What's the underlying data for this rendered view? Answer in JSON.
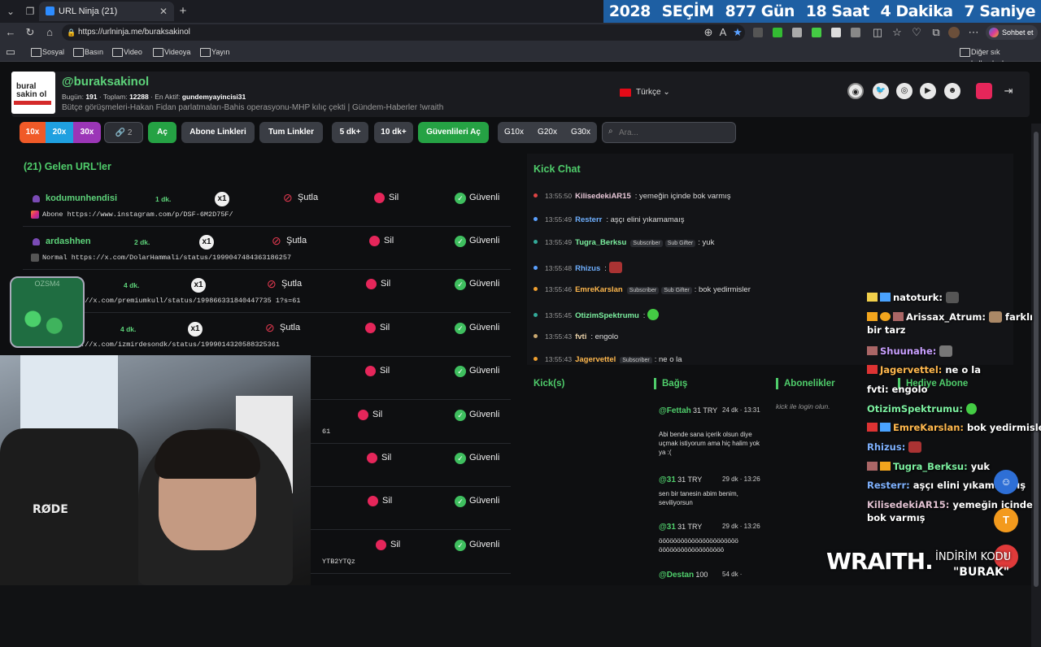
{
  "browser": {
    "tab_title": "URL Ninja (21)",
    "url": "https://urlninja.me/buraksakinol",
    "copilot_label": "Sohbet et",
    "bookmarks": [
      "Sosyal",
      "Basın",
      "Video",
      "Videoya",
      "Yayın"
    ],
    "other_bookmarks": "Diğer sık kullanılanlar"
  },
  "countdown": {
    "year": "2028",
    "election": "SEÇİM",
    "days": "877 Gün",
    "hours": "18 Saat",
    "minutes": "4 Dakika",
    "seconds": "7 Saniye"
  },
  "profile": {
    "logo_text_1": "bural",
    "logo_text_2": "sakin",
    "logo_text_3": "ol",
    "username": "@buraksakinol",
    "today_label": "Bugün:",
    "today": "191",
    "total_label": "Toplam:",
    "total": "12288",
    "active_label": "En Aktif:",
    "active": "gundemyayincisi31",
    "bio": "Bütçe görüşmeleri-Hakan Fidan parlatmaları-Bahis operasyonu-MHP kılıç çekti | Gündem-Haberler !wraith",
    "language": "Türkçe"
  },
  "toolbar": {
    "b10x": "10x",
    "b20x": "20x",
    "b30x": "30x",
    "link_count": "2",
    "ac": "Aç",
    "abone_linkleri": "Abone Linkleri",
    "tum_linkler": "Tum Linkler",
    "dk5": "5 dk+",
    "dk10": "10 dk+",
    "guvenli_ac": "Güvenlileri Aç",
    "g10": "G10x",
    "g20": "G20x",
    "g30": "G30x",
    "search_placeholder": "Ara..."
  },
  "list": {
    "title": "(21) Gelen URL'ler",
    "sutla": "Şutla",
    "sil": "Sil",
    "guvenli": "Güvenli",
    "x1": "x1",
    "rows": [
      {
        "user": "kodumunhendisi",
        "time": "1 dk.",
        "link": "Abone https://www.instagram.com/p/DSF-6M2D75F/"
      },
      {
        "user": "ardashhen",
        "time": "2 dk.",
        "link": "Normal https://x.com/DolarHammali/status/1999047484363186257"
      },
      {
        "user": "",
        "time": "4 dk.",
        "link": "s://x.com/premiumkull/status/199866331840447735 1?s=61"
      },
      {
        "user": "",
        "time": "4 dk.",
        "link": "s://x.com/izmirdesondk/status/1999014320588325361"
      },
      {
        "user": "",
        "time": "",
        "link": ""
      },
      {
        "user": "",
        "time": "",
        "link": "61"
      },
      {
        "user": "",
        "time": "",
        "link": ""
      },
      {
        "user": "",
        "time": "",
        "link": ""
      },
      {
        "user": "",
        "time": "",
        "link": "YTB2YTQz"
      }
    ]
  },
  "kick_chat": {
    "title": "Kick Chat",
    "messages": [
      {
        "ts": "13:55:50",
        "name": "KilisedekiAR15",
        "text": ": yemeğin içinde bok varmış",
        "badges": []
      },
      {
        "ts": "13:55:49",
        "name": "Resterr",
        "text": ": aşçı elini yıkamamaış",
        "badges": []
      },
      {
        "ts": "13:55:49",
        "name": "Tugra_Berksu",
        "text": ": yuk",
        "badges": [
          "Subscriber",
          "Sub Gifter"
        ]
      },
      {
        "ts": "13:55:48",
        "name": "Rhizus",
        "text": ":",
        "badges": []
      },
      {
        "ts": "13:55:46",
        "name": "EmreKarslan",
        "text": ": bok yedirmisler",
        "badges": [
          "Subscriber",
          "Sub Gifter"
        ]
      },
      {
        "ts": "13:55:45",
        "name": "OtizimSpektrumu",
        "text": ":",
        "badges": []
      },
      {
        "ts": "13:55:43",
        "name": "fvti",
        "text": ": engolo",
        "badges": []
      },
      {
        "ts": "13:55:43",
        "name": "Jagervettel",
        "text": ": ne o la",
        "badges": [
          "Subscriber"
        ]
      }
    ]
  },
  "panels": {
    "kicks": "Kick(s)",
    "bagis": "Bağış",
    "aboneler": "Abonelikler",
    "hediye": "Hediye Abone",
    "login": "kick ile login olun."
  },
  "donations": [
    {
      "name": "@Fettah",
      "amount": "31 TRY",
      "time": "24 dk · 13:31",
      "msg": "Abi bende sana içerik olsun diye uçmak istiyorum ama hiç halim yok ya :("
    },
    {
      "name": "@31",
      "amount": "31 TRY",
      "time": "29 dk · 13:26",
      "msg": "sen bir tanesin abim benim, seviliyorsun"
    },
    {
      "name": "@31",
      "amount": "31 TRY",
      "time": "29 dk · 13:26",
      "msg": "öööööööööööööööööööööö öööööööööööööööööö"
    },
    {
      "name": "@Destan",
      "amount": "100",
      "time": "54 dk ·",
      "msg": ""
    }
  ],
  "stream_overlay": {
    "jar_label": "OZSM4",
    "rode": "RØDE",
    "wraith": "WRAITH.",
    "indirim": "İNDİRİM KODU",
    "burak": "\"BURAK\"",
    "chat": [
      {
        "name": "natoturk:",
        "text": "",
        "color": "#ffffff"
      },
      {
        "name": "Arissax_Atrum:",
        "text": "farklı bir tarz",
        "color": "#ffffff"
      },
      {
        "name": "Shuunahe:",
        "text": "",
        "color": "#c9a0ff"
      },
      {
        "name": "Jagervettel:",
        "text": "ne o la",
        "color": "#ffb84d"
      },
      {
        "name": "fvti:",
        "text": "engolo",
        "color": "#ffffff"
      },
      {
        "name": "OtizimSpektrumu:",
        "text": "",
        "color": "#7cf0a0"
      },
      {
        "name": "EmreKarslan:",
        "text": "bok yedirmisler",
        "color": "#ffb84d"
      },
      {
        "name": "Rhizus:",
        "text": "",
        "color": "#7fb2ff"
      },
      {
        "name": "Tugra_Berksu:",
        "text": "yuk",
        "color": "#7cf0a0"
      },
      {
        "name": "Resterr:",
        "text": "aşçı elini yıkamamaış",
        "color": "#7fb2ff"
      },
      {
        "name": "KilisedekiAR15:",
        "text": "yemeğin içinde bok varmış",
        "color": "#e0c0d0"
      }
    ]
  }
}
